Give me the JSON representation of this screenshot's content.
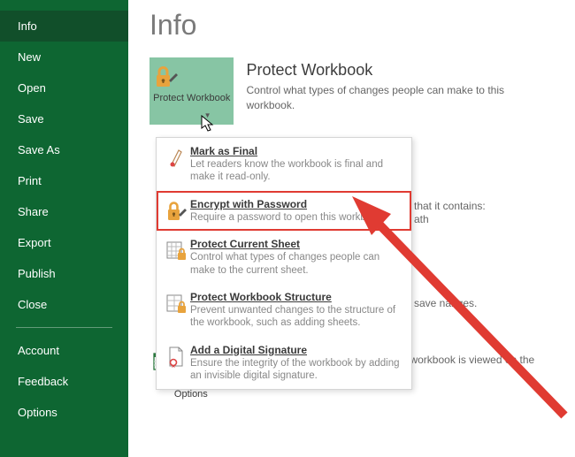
{
  "sidebar": {
    "items": [
      {
        "label": "Info"
      },
      {
        "label": "New"
      },
      {
        "label": "Open"
      },
      {
        "label": "Save"
      },
      {
        "label": "Save As"
      },
      {
        "label": "Print"
      },
      {
        "label": "Share"
      },
      {
        "label": "Export"
      },
      {
        "label": "Publish"
      },
      {
        "label": "Close"
      }
    ],
    "footer": [
      {
        "label": "Account"
      },
      {
        "label": "Feedback"
      },
      {
        "label": "Options"
      }
    ]
  },
  "page": {
    "title": "Info"
  },
  "protect": {
    "tile_label": "Protect Workbook",
    "heading": "Protect Workbook",
    "desc": "Control what types of changes people can make to this workbook."
  },
  "dropdown": {
    "items": [
      {
        "title": "Mark as Final",
        "desc": "Let readers know the workbook is final and make it read-only."
      },
      {
        "title": "Encrypt with Password",
        "desc": "Require a password to open this workbook."
      },
      {
        "title": "Protect Current Sheet",
        "desc": "Control what types of changes people can make to the current sheet."
      },
      {
        "title": "Protect Workbook Structure",
        "desc": "Prevent unwanted changes to the structure of the workbook, such as adding sheets."
      },
      {
        "title": "Add a Digital Signature",
        "desc": "Ensure the integrity of the workbook by adding an invisible digital signature."
      }
    ]
  },
  "peek": {
    "contains": "that it contains:",
    "path": "ath",
    "save": "save   nanges."
  },
  "browser": {
    "tile_label": "Browser View Options",
    "desc": "Pick what users can see when this workbook is viewed on the Web."
  }
}
